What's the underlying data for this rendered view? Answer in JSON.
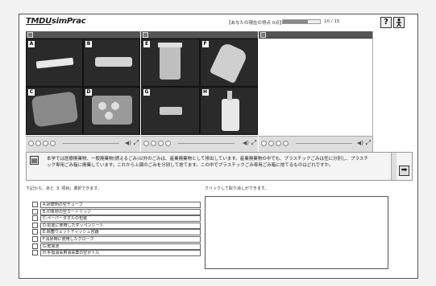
{
  "header": {
    "logo": "TMDUsimPrac",
    "score_text": "【あなたの現在の得点 0点】",
    "progress_text": "10 / 15",
    "progress_fraction": 0.67,
    "help_label": "?",
    "help_icon": "question-icon",
    "person_icon": "person-icon"
  },
  "panels": {
    "labels": [
      "A",
      "B",
      "C",
      "D",
      "E",
      "F",
      "G",
      "H"
    ]
  },
  "textbar": {
    "text": "本学では医療廃棄物、一般廃棄物(燃えるごみ)以外のごみは、産業廃棄物として排出しています。産業廃棄物の中でも、プラスチックごみは任に分別し、プラスチック専用ごみ箱に廃棄しています。これから上図のごみを分別して捨てます。この中でプラスチックごみ専用ごみ箱に捨てるものはどれですか。"
  },
  "instructions": {
    "left_prefix": "下記から、あと",
    "count": "3",
    "left_suffix": "項目」選択できます。",
    "right": "クリックして取り消しができます。"
  },
  "options": [
    "A.研磨剤の空チューブ",
    "B.印象材の空カートリッジ",
    "C.ペーパータオルの包装",
    "D.処置に使用したダッペンシート",
    "E.除菌ウェットティッシュ容器",
    "F.清掃時に使用したグローブ",
    "G.乾電池",
    "H.手指消毒用消毒薬の空ボトル"
  ]
}
